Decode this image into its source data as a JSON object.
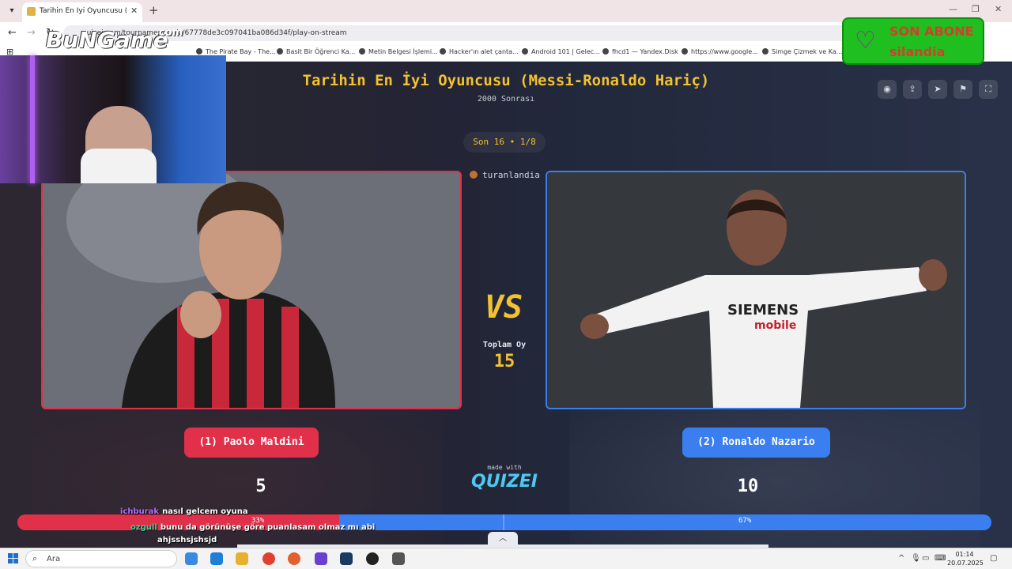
{
  "browser": {
    "tab_title": "Tarihin En İyi Oyuncusu (Messi-Ronaldo Hariç)",
    "url": "quizei.com/tournament/quiz/67778de3c097041ba086d34f/play-on-stream",
    "bookmarks": [
      "The Pirate Bay - The...",
      "Basit Bir Öğrenci Ka...",
      "Metin Belgesi İşlemi...",
      "Hacker'ın alet çanta...",
      "Android 101 | Gelec...",
      "fhcd1 — Yandex.Disk",
      "https://www.google...",
      "Simge Çizmek ve Ka..."
    ]
  },
  "quiz": {
    "title": "Tarihin En İyi Oyuncusu (Messi-Ronaldo Hariç)",
    "subtitle": "2000 Sonrası",
    "round": "Son 16 • 1/8",
    "streamer": "turanlandia",
    "vs_label": "VS",
    "total_label": "Toplam Oy",
    "total_value": "15",
    "made_with": "made with",
    "brand": "QUIZEI"
  },
  "left": {
    "label": "(1) Paolo Maldini",
    "votes": "5",
    "percent_label": "33%",
    "percent": 33,
    "color": "#e0304a"
  },
  "right": {
    "label": "(2) Ronaldo Nazario",
    "votes": "10",
    "percent_label": "67%",
    "percent": 67,
    "color": "#3a7ef0"
  },
  "icons": [
    "eye-icon",
    "share-icon",
    "send-icon",
    "flag-icon",
    "fullscreen-icon"
  ],
  "overlay": {
    "logo_text": "BuNGame",
    "logo_sup": ".com",
    "sub_title": "SON ABONE",
    "sub_name": "silandia"
  },
  "chat": [
    {
      "user": "ichburak",
      "message": "nasıl gelcem oyuna",
      "color": "#b070ff"
    },
    {
      "user": "ozgull",
      "message": "bunu da görünüşe göre puanlasam olmaz mı abi",
      "color": "#40d0a0"
    },
    {
      "user": "",
      "message": "ahjsshsjshsjd",
      "color": "#ffffff"
    }
  ],
  "taskbar": {
    "search_placeholder": "Ara",
    "time": "01:14",
    "date": "20.07.2025"
  }
}
